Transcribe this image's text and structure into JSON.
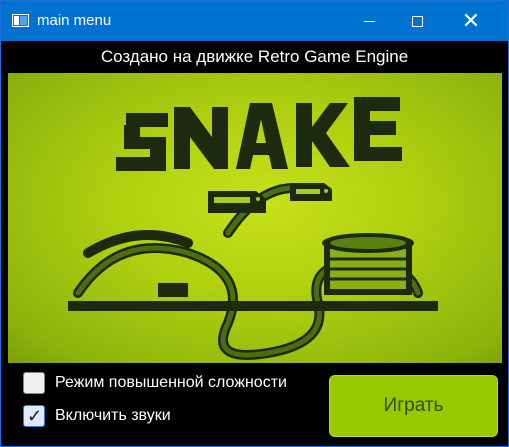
{
  "window": {
    "title": "main menu",
    "controls": [
      "minimize-icon",
      "maximize-icon",
      "close-icon"
    ],
    "accent_color": "#0073d1"
  },
  "banner": {
    "text": "Создано на движке Retro Game Engine"
  },
  "artwork": {
    "logo_text": "SNAKE",
    "background_color": "#b0d010",
    "ink_color": "#1e2a10"
  },
  "options": {
    "hard_mode": {
      "label": "Режим повышенной сложности",
      "checked": false
    },
    "sound": {
      "label": "Включить звуки",
      "checked": true
    }
  },
  "play_button": {
    "label": "Играть",
    "color": "#98c800"
  }
}
